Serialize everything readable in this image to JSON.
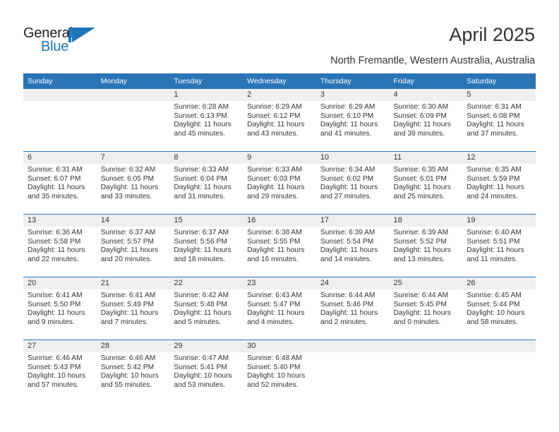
{
  "logo": {
    "word1": "General",
    "word2": "Blue",
    "mark": "triangle-flag-mark",
    "color": "#1b75bc"
  },
  "header": {
    "title": "April 2025",
    "subtitle": "North Fremantle, Western Australia, Australia"
  },
  "colors": {
    "header_blue": "#2a74b6",
    "daynum_band": "#efefef",
    "text": "#333333"
  },
  "weekday_headers": [
    "Sunday",
    "Monday",
    "Tuesday",
    "Wednesday",
    "Thursday",
    "Friday",
    "Saturday"
  ],
  "weeks": [
    [
      {
        "day": "",
        "sunrise": "",
        "sunset": "",
        "daylight1": "",
        "daylight2": ""
      },
      {
        "day": "",
        "sunrise": "",
        "sunset": "",
        "daylight1": "",
        "daylight2": ""
      },
      {
        "day": "1",
        "sunrise": "Sunrise: 6:28 AM",
        "sunset": "Sunset: 6:13 PM",
        "daylight1": "Daylight: 11 hours",
        "daylight2": "and 45 minutes."
      },
      {
        "day": "2",
        "sunrise": "Sunrise: 6:29 AM",
        "sunset": "Sunset: 6:12 PM",
        "daylight1": "Daylight: 11 hours",
        "daylight2": "and 43 minutes."
      },
      {
        "day": "3",
        "sunrise": "Sunrise: 6:29 AM",
        "sunset": "Sunset: 6:10 PM",
        "daylight1": "Daylight: 11 hours",
        "daylight2": "and 41 minutes."
      },
      {
        "day": "4",
        "sunrise": "Sunrise: 6:30 AM",
        "sunset": "Sunset: 6:09 PM",
        "daylight1": "Daylight: 11 hours",
        "daylight2": "and 39 minutes."
      },
      {
        "day": "5",
        "sunrise": "Sunrise: 6:31 AM",
        "sunset": "Sunset: 6:08 PM",
        "daylight1": "Daylight: 11 hours",
        "daylight2": "and 37 minutes."
      }
    ],
    [
      {
        "day": "6",
        "sunrise": "Sunrise: 6:31 AM",
        "sunset": "Sunset: 6:07 PM",
        "daylight1": "Daylight: 11 hours",
        "daylight2": "and 35 minutes."
      },
      {
        "day": "7",
        "sunrise": "Sunrise: 6:32 AM",
        "sunset": "Sunset: 6:05 PM",
        "daylight1": "Daylight: 11 hours",
        "daylight2": "and 33 minutes."
      },
      {
        "day": "8",
        "sunrise": "Sunrise: 6:33 AM",
        "sunset": "Sunset: 6:04 PM",
        "daylight1": "Daylight: 11 hours",
        "daylight2": "and 31 minutes."
      },
      {
        "day": "9",
        "sunrise": "Sunrise: 6:33 AM",
        "sunset": "Sunset: 6:03 PM",
        "daylight1": "Daylight: 11 hours",
        "daylight2": "and 29 minutes."
      },
      {
        "day": "10",
        "sunrise": "Sunrise: 6:34 AM",
        "sunset": "Sunset: 6:02 PM",
        "daylight1": "Daylight: 11 hours",
        "daylight2": "and 27 minutes."
      },
      {
        "day": "11",
        "sunrise": "Sunrise: 6:35 AM",
        "sunset": "Sunset: 6:01 PM",
        "daylight1": "Daylight: 11 hours",
        "daylight2": "and 25 minutes."
      },
      {
        "day": "12",
        "sunrise": "Sunrise: 6:35 AM",
        "sunset": "Sunset: 5:59 PM",
        "daylight1": "Daylight: 11 hours",
        "daylight2": "and 24 minutes."
      }
    ],
    [
      {
        "day": "13",
        "sunrise": "Sunrise: 6:36 AM",
        "sunset": "Sunset: 5:58 PM",
        "daylight1": "Daylight: 11 hours",
        "daylight2": "and 22 minutes."
      },
      {
        "day": "14",
        "sunrise": "Sunrise: 6:37 AM",
        "sunset": "Sunset: 5:57 PM",
        "daylight1": "Daylight: 11 hours",
        "daylight2": "and 20 minutes."
      },
      {
        "day": "15",
        "sunrise": "Sunrise: 6:37 AM",
        "sunset": "Sunset: 5:56 PM",
        "daylight1": "Daylight: 11 hours",
        "daylight2": "and 18 minutes."
      },
      {
        "day": "16",
        "sunrise": "Sunrise: 6:38 AM",
        "sunset": "Sunset: 5:55 PM",
        "daylight1": "Daylight: 11 hours",
        "daylight2": "and 16 minutes."
      },
      {
        "day": "17",
        "sunrise": "Sunrise: 6:39 AM",
        "sunset": "Sunset: 5:54 PM",
        "daylight1": "Daylight: 11 hours",
        "daylight2": "and 14 minutes."
      },
      {
        "day": "18",
        "sunrise": "Sunrise: 6:39 AM",
        "sunset": "Sunset: 5:52 PM",
        "daylight1": "Daylight: 11 hours",
        "daylight2": "and 13 minutes."
      },
      {
        "day": "19",
        "sunrise": "Sunrise: 6:40 AM",
        "sunset": "Sunset: 5:51 PM",
        "daylight1": "Daylight: 11 hours",
        "daylight2": "and 11 minutes."
      }
    ],
    [
      {
        "day": "20",
        "sunrise": "Sunrise: 6:41 AM",
        "sunset": "Sunset: 5:50 PM",
        "daylight1": "Daylight: 11 hours",
        "daylight2": "and 9 minutes."
      },
      {
        "day": "21",
        "sunrise": "Sunrise: 6:41 AM",
        "sunset": "Sunset: 5:49 PM",
        "daylight1": "Daylight: 11 hours",
        "daylight2": "and 7 minutes."
      },
      {
        "day": "22",
        "sunrise": "Sunrise: 6:42 AM",
        "sunset": "Sunset: 5:48 PM",
        "daylight1": "Daylight: 11 hours",
        "daylight2": "and 5 minutes."
      },
      {
        "day": "23",
        "sunrise": "Sunrise: 6:43 AM",
        "sunset": "Sunset: 5:47 PM",
        "daylight1": "Daylight: 11 hours",
        "daylight2": "and 4 minutes."
      },
      {
        "day": "24",
        "sunrise": "Sunrise: 6:44 AM",
        "sunset": "Sunset: 5:46 PM",
        "daylight1": "Daylight: 11 hours",
        "daylight2": "and 2 minutes."
      },
      {
        "day": "25",
        "sunrise": "Sunrise: 6:44 AM",
        "sunset": "Sunset: 5:45 PM",
        "daylight1": "Daylight: 11 hours",
        "daylight2": "and 0 minutes."
      },
      {
        "day": "26",
        "sunrise": "Sunrise: 6:45 AM",
        "sunset": "Sunset: 5:44 PM",
        "daylight1": "Daylight: 10 hours",
        "daylight2": "and 58 minutes."
      }
    ],
    [
      {
        "day": "27",
        "sunrise": "Sunrise: 6:46 AM",
        "sunset": "Sunset: 5:43 PM",
        "daylight1": "Daylight: 10 hours",
        "daylight2": "and 57 minutes."
      },
      {
        "day": "28",
        "sunrise": "Sunrise: 6:46 AM",
        "sunset": "Sunset: 5:42 PM",
        "daylight1": "Daylight: 10 hours",
        "daylight2": "and 55 minutes."
      },
      {
        "day": "29",
        "sunrise": "Sunrise: 6:47 AM",
        "sunset": "Sunset: 5:41 PM",
        "daylight1": "Daylight: 10 hours",
        "daylight2": "and 53 minutes."
      },
      {
        "day": "30",
        "sunrise": "Sunrise: 6:48 AM",
        "sunset": "Sunset: 5:40 PM",
        "daylight1": "Daylight: 10 hours",
        "daylight2": "and 52 minutes."
      },
      {
        "day": "",
        "sunrise": "",
        "sunset": "",
        "daylight1": "",
        "daylight2": ""
      },
      {
        "day": "",
        "sunrise": "",
        "sunset": "",
        "daylight1": "",
        "daylight2": ""
      },
      {
        "day": "",
        "sunrise": "",
        "sunset": "",
        "daylight1": "",
        "daylight2": ""
      }
    ]
  ]
}
